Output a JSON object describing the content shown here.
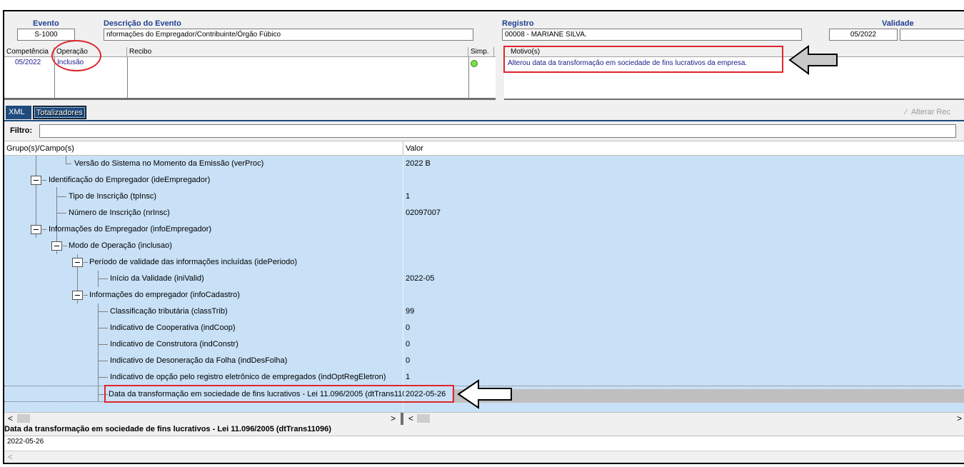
{
  "header": {
    "evento_label": "Evento",
    "evento_value": "S-1000",
    "descricao_label": "Descrição do Evento",
    "descricao_value": "nformações do Empregador/Contribuinte/Órgão Fúbico",
    "registro_label": "Registro",
    "registro_value": "00008 - MARIANE SILVA.",
    "validade_label": "Validade",
    "validade_value": "05/2022"
  },
  "grid": {
    "columns": [
      "Competência",
      "Operação",
      "Recibo",
      "Simp.",
      "Motivo(s)"
    ],
    "row": {
      "competencia": "05/2022",
      "operacao": "Inclusão",
      "recibo": "",
      "motivo": "Alterou data da transformação em sociedade de fins lucrativos da empresa."
    }
  },
  "tabs": [
    {
      "label": "XML",
      "active": false
    },
    {
      "label": "Totalizadores",
      "active": true
    }
  ],
  "toolbar": {
    "alterar_label": "Alterar Rec"
  },
  "filter": {
    "label": "Filtro:",
    "value": ""
  },
  "tree": {
    "col_campo": "Grupo(s)/Campo(s)",
    "col_valor": "Valor",
    "rows": [
      {
        "label": "Versão do Sistema no Momento da Emissão (verProc)",
        "value": "2022 B"
      },
      {
        "label": "Identificação do Empregador (ideEmpregador)",
        "value": ""
      },
      {
        "label": "Tipo de Inscrição (tpInsc)",
        "value": "1"
      },
      {
        "label": "Número de Inscrição (nrInsc)",
        "value": "02097007"
      },
      {
        "label": "Informações do Empregador (infoEmpregador)",
        "value": ""
      },
      {
        "label": "Modo de Operação (inclusao)",
        "value": ""
      },
      {
        "label": "Período de validade das informações incluídas (idePeriodo)",
        "value": ""
      },
      {
        "label": "Início da Validade (iniValid)",
        "value": "2022-05"
      },
      {
        "label": "Informações do empregador (infoCadastro)",
        "value": ""
      },
      {
        "label": "Classificação tributária (classTrib)",
        "value": "99"
      },
      {
        "label": "Indicativo de Cooperativa (indCoop)",
        "value": "0"
      },
      {
        "label": "Indicativo de Construtora (indConstr)",
        "value": "0"
      },
      {
        "label": "Indicativo de Desoneração da Folha (indDesFolha)",
        "value": "0"
      },
      {
        "label": "Indicativo de opção pelo registro eletrônico de empregados (indOptRegEletron)",
        "value": "1"
      },
      {
        "label": "Data da transformação em sociedade de fins lucrativos - Lei 11.096/2005 (dtTrans11096)",
        "value": "2022-05-26"
      }
    ]
  },
  "detail": {
    "title": "Data da transformação em sociedade de fins lucrativos - Lei 11.096/2005 (dtTrans11096)",
    "value": "2022-05-26"
  },
  "colors": {
    "tree_bg": "#c9e1f7",
    "selected_bg": "#bfbfbf",
    "highlight_red": "#e0262d",
    "header_blue": "#1f3f8f"
  }
}
